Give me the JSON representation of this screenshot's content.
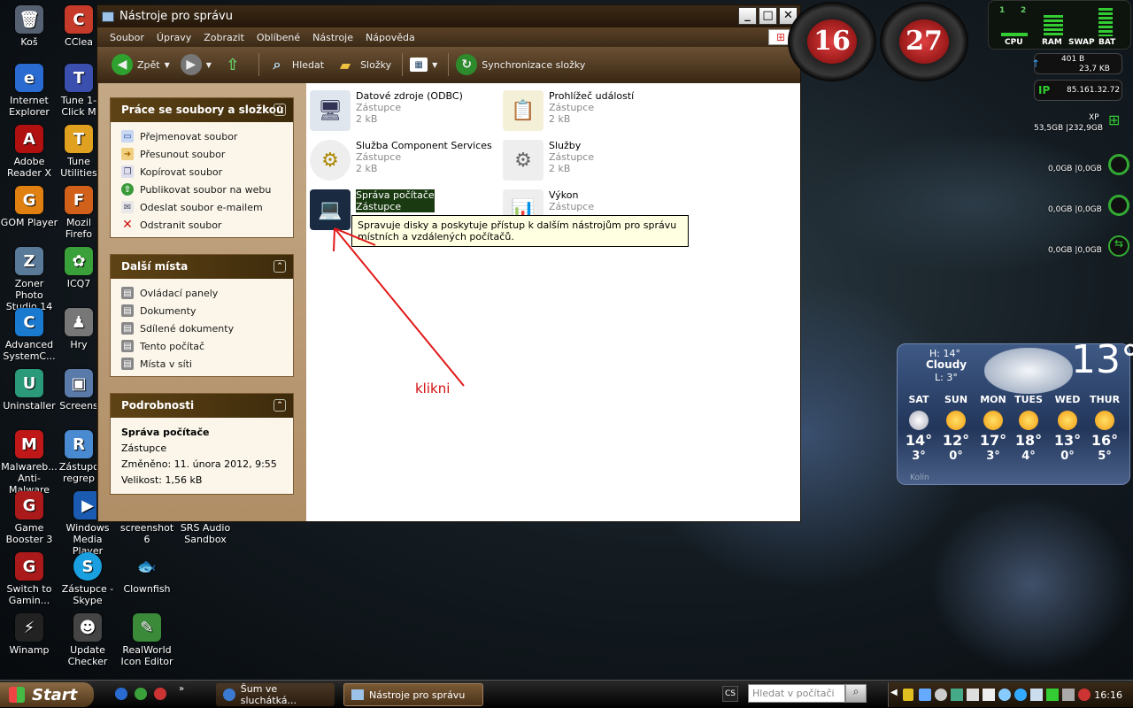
{
  "desktop_icons": [
    {
      "label": "Koš",
      "color": "#556070",
      "glyph": "🗑"
    },
    {
      "label": "CClea",
      "color": "#c63a2a",
      "glyph": "C"
    },
    {
      "label": "Internet Explorer",
      "color": "#2a6bd1",
      "glyph": "e"
    },
    {
      "label": "Tune 1-Click M",
      "color": "#3a4fae",
      "glyph": "T"
    },
    {
      "label": "Adobe Reader X",
      "color": "#b01010",
      "glyph": "A"
    },
    {
      "label": "Tune Utilities",
      "color": "#e0a020",
      "glyph": "T"
    },
    {
      "label": "GOM Player",
      "color": "#e08010",
      "glyph": "G"
    },
    {
      "label": "Mozil Firefo",
      "color": "#d0601a",
      "glyph": "F"
    },
    {
      "label": "Zoner Photo Studio 14",
      "color": "#5a7a9a",
      "glyph": "Z"
    },
    {
      "label": "ICQ7",
      "color": "#3aa03a",
      "glyph": "✿"
    },
    {
      "label": "Advanced SystemC...",
      "color": "#1a7ad0",
      "glyph": "C"
    },
    {
      "label": "Hry",
      "color": "#777",
      "glyph": "♟"
    },
    {
      "label": "Uninstaller",
      "color": "#2a9a7a",
      "glyph": "U"
    },
    {
      "label": "Screens",
      "color": "#5a7aaa",
      "glyph": "▣"
    },
    {
      "label": "Malwareb... Anti-Malware",
      "color": "#c01818",
      "glyph": "M"
    },
    {
      "label": "Zástupc regrep",
      "color": "#4a8ad0",
      "glyph": "R"
    },
    {
      "label": "Game Booster 3",
      "color": "#aa1a1a",
      "glyph": "G"
    },
    {
      "label": "Windows Media Player",
      "color": "#1a5ab0",
      "glyph": "▶"
    },
    {
      "label": "screenshot 6",
      "color": "transparent",
      "glyph": ""
    },
    {
      "label": "SRS Audio Sandbox",
      "color": "transparent",
      "glyph": ""
    },
    {
      "label": "Switch to Gamin...",
      "color": "#aa1a1a",
      "glyph": "G"
    },
    {
      "label": "Zástupce - Skype",
      "color": "#1aa0e0",
      "glyph": "S"
    },
    {
      "label": "Clownfish",
      "color": "transparent",
      "glyph": "🐟"
    },
    {
      "label": "Winamp",
      "color": "#222",
      "glyph": "⚡"
    },
    {
      "label": "Update Checker",
      "color": "#444",
      "glyph": "☻"
    },
    {
      "label": "RealWorld Icon Editor",
      "color": "#3a8a3a",
      "glyph": "✎"
    }
  ],
  "window": {
    "title": "Nástroje pro správu",
    "menu": [
      "Soubor",
      "Úpravy",
      "Zobrazit",
      "Oblíbené",
      "Nástroje",
      "Nápověda"
    ],
    "toolbar": {
      "back": "Zpět",
      "search": "Hledat",
      "folders": "Složky",
      "sync": "Synchronizace složky"
    },
    "panels": {
      "file_tasks": {
        "title": "Práce se soubory a složkou",
        "items": [
          "Přejmenovat soubor",
          "Přesunout soubor",
          "Kopírovat soubor",
          "Publikovat soubor na webu",
          "Odeslat soubor e-mailem",
          "Odstranit soubor"
        ]
      },
      "other_places": {
        "title": "Další místa",
        "items": [
          "Ovládací panely",
          "Dokumenty",
          "Sdílené dokumenty",
          "Tento počítač",
          "Místa v síti"
        ]
      },
      "details": {
        "title": "Podrobnosti",
        "name": "Správa počítače",
        "type": "Zástupce",
        "modified": "Změněno: 11. února 2012, 9:55",
        "size": "Velikost: 1,56 kB"
      }
    },
    "files": [
      {
        "name": "Datové zdroje (ODBC)",
        "type": "Zástupce",
        "size": "2 kB",
        "glyph": "🖥"
      },
      {
        "name": "Prohlížeč událostí",
        "type": "Zástupce",
        "size": "2 kB",
        "glyph": "📋"
      },
      {
        "name": "Služba Component Services",
        "type": "Zástupce",
        "size": "2 kB",
        "glyph": "⚙"
      },
      {
        "name": "Služby",
        "type": "Zástupce",
        "size": "2 kB",
        "glyph": "⚙"
      },
      {
        "name": "Správa počítače",
        "type": "Zástupce",
        "size": "",
        "glyph": "💻"
      },
      {
        "name": "Výkon",
        "type": "Zástupce",
        "size": "",
        "glyph": "📊"
      }
    ],
    "tooltip": "Spravuje disky a poskytuje přístup k dalším nástrojům pro správu místních a vzdálených počítačů."
  },
  "annotation": "klikni",
  "gadgets": {
    "clock1": "16",
    "clock2": "27",
    "meters": [
      "CPU",
      "RAM",
      "SWAP",
      "BAT"
    ],
    "meter_tabs": [
      "1",
      "2"
    ],
    "net_up": "401 B",
    "net_down": "23,7 KB",
    "ip_label": "IP",
    "ip": "85.161.32.72",
    "os": "XP",
    "disk": "53,5GB |232,9GB",
    "drives": [
      "0,0GB |0,0GB",
      "0,0GB |0,0GB",
      "0,0GB |0,0GB"
    ]
  },
  "weather": {
    "hi": "H: 14°",
    "cond": "Cloudy",
    "lo": "L: 3°",
    "temp": "13°",
    "city": "Kolín",
    "days": [
      {
        "d": "SAT",
        "h": "14°",
        "l": "3°"
      },
      {
        "d": "SUN",
        "h": "12°",
        "l": "0°"
      },
      {
        "d": "MON",
        "h": "17°",
        "l": "3°"
      },
      {
        "d": "TUES",
        "h": "18°",
        "l": "4°"
      },
      {
        "d": "WED",
        "h": "13°",
        "l": "0°"
      },
      {
        "d": "THUR",
        "h": "16°",
        "l": "5°"
      }
    ]
  },
  "taskbar": {
    "start": "Start",
    "tasks": [
      "Šum ve sluchátká...",
      "Nástroje pro správu"
    ],
    "lang": "CS",
    "search_placeholder": "Hledat v počítači",
    "time": "16:16"
  }
}
